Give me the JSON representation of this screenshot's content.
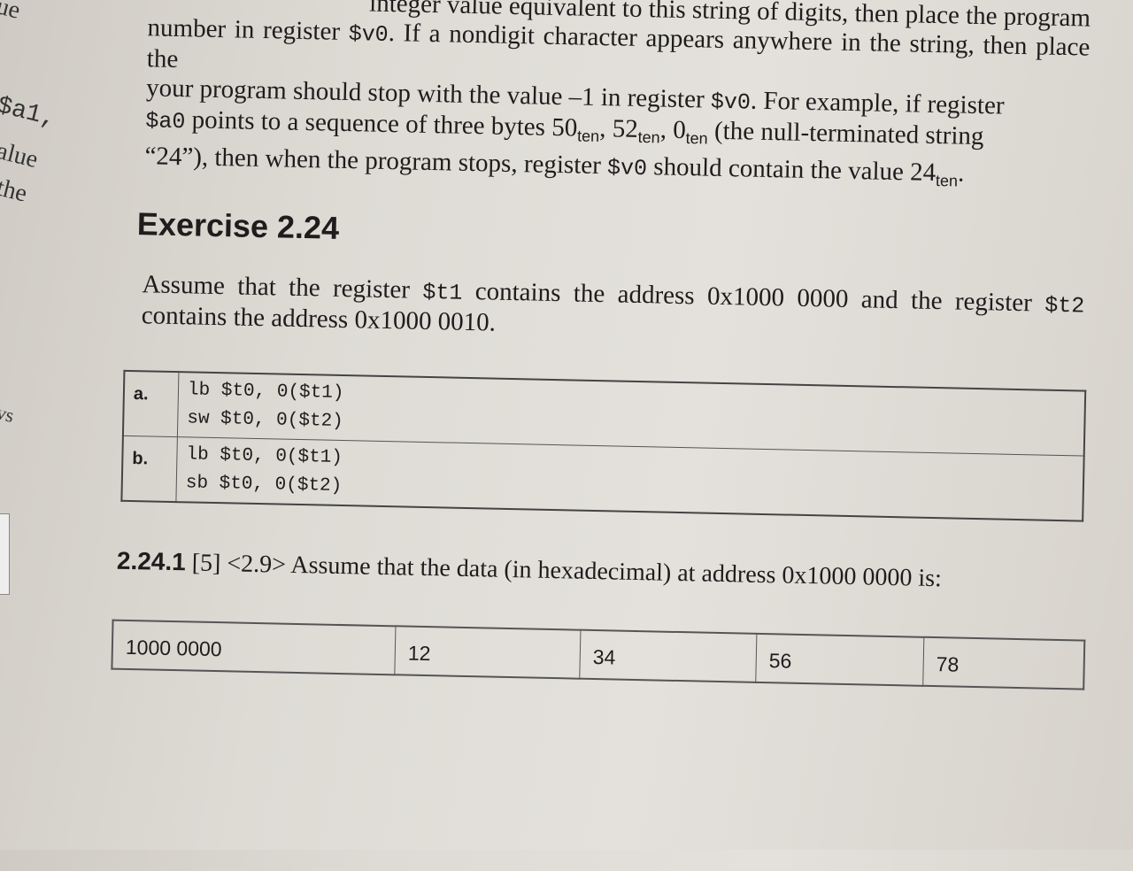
{
  "margin_fragments": [
    "ue",
    "$a1,",
    "alue",
    "the",
    "vs"
  ],
  "intro": {
    "line0": "integer value equivalent to this string of digits, then place the program",
    "l1a": "number in register ",
    "r_v0": "$v0",
    "l1b": ". If a nondigit character appears anywhere in the string, then place the",
    "l2": "your program should stop with the value –1 in register ",
    "l3a": "points to a sequence of three bytes 50",
    "ten": "ten",
    "r_a0": "$a0",
    "n52": "52",
    "n0": "0",
    "l3b": "(the null-terminated string",
    "l4a": "“24”), then when the program stops, register ",
    "l4b": " should contain the value 24",
    "l2b": ". For example, if register"
  },
  "exercise": {
    "title": "Exercise 2.24",
    "p_a": "Assume that the register ",
    "t1": "$t1",
    "p_b": " contains the address 0x1000 0000 and the register ",
    "t2": "$t2",
    "p_c": " contains the address 0x1000 0010."
  },
  "code_table": [
    {
      "label": "a.",
      "lines": [
        "lb $t0, 0($t1)",
        "sw $t0, 0($t2)"
      ]
    },
    {
      "label": "b.",
      "lines": [
        "lb $t0, 0($t1)",
        "sb $t0, 0($t2)"
      ]
    }
  ],
  "question": {
    "number": "2.24.1",
    "text": " [5] <2.9> Assume that the data (in hexadecimal) at address 0x1000 0000 is:"
  },
  "data_table": [
    "1000 0000",
    "12",
    "34",
    "56",
    "78"
  ]
}
